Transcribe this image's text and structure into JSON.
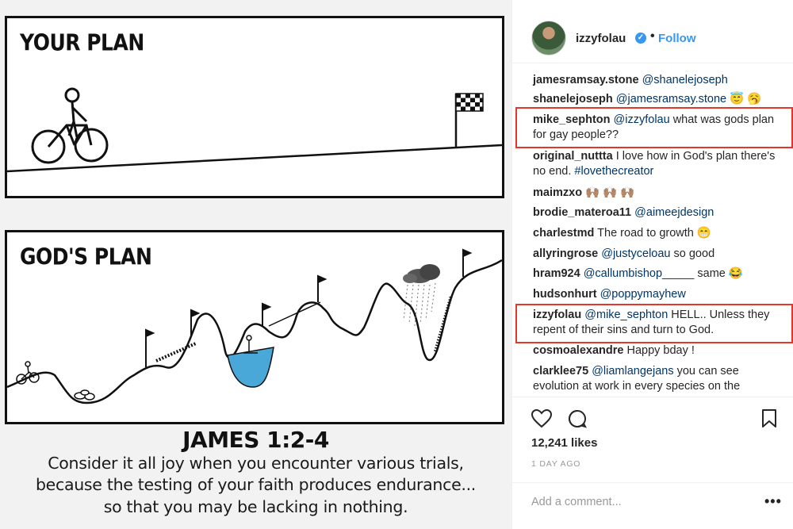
{
  "image": {
    "panel_top_title": "YOUR PLAN",
    "panel_bottom_title": "GOD'S PLAN",
    "verse_ref": "JAMES 1:2-4",
    "verse_lines": [
      "Consider it all joy when you encounter various trials,",
      "because the testing of your faith produces endurance...",
      "so that you may be lacking in nothing."
    ]
  },
  "header": {
    "username": "izzyfolau",
    "separator": "•",
    "follow_label": "Follow"
  },
  "comments": [
    {
      "user": "jamesramsay.stone",
      "mention": "@shanelejoseph",
      "text": ""
    },
    {
      "user": "shanelejoseph",
      "mention": "@jamesramsay.stone",
      "text": " 😇 🥱"
    },
    {
      "user": "mike_sephton",
      "mention": "@izzyfolau",
      "text": " what was gods plan for gay people??",
      "highlighted": true
    },
    {
      "user": "original_nuttta",
      "mention": "",
      "text": "I love how in God's plan there's no end.",
      "tag": " #lovethecreator"
    },
    {
      "user": "maimzxo",
      "mention": "",
      "text": "🙌🏽 🙌🏽 🙌🏽"
    },
    {
      "user": "brodie_materoa11",
      "mention": "@aimeejdesign",
      "text": ""
    },
    {
      "user": "charlestmd",
      "mention": "",
      "text": "The road to growth 😁"
    },
    {
      "user": "allyringrose",
      "mention": "@justyceloau",
      "text": " so good"
    },
    {
      "user": "hram924",
      "mention": "@callumbishop_____",
      "text": " same 😂"
    },
    {
      "user": "hudsonhurt",
      "mention": "@poppymayhew",
      "text": ""
    },
    {
      "user": "izzyfolau",
      "mention": "@mike_sephton",
      "text": " HELL.. Unless they repent of their sins and turn to God.",
      "highlighted": true
    },
    {
      "user": "cosmoalexandre",
      "mention": "",
      "text": "Happy bday !"
    },
    {
      "user": "clarklee75",
      "mention": "@liamlangejans",
      "text": " you can see evolution at work in every species on the"
    }
  ],
  "actions": {
    "likes": "12,241 likes",
    "time": "1 DAY AGO",
    "add_comment_placeholder": "Add a comment...",
    "more": "•••",
    "icons": [
      "heart-icon",
      "comment-icon",
      "bookmark-icon"
    ]
  },
  "colors": {
    "link": "#003569",
    "follow": "#3897f0",
    "highlight": "#e0392b",
    "water": "#4aa8d8"
  }
}
